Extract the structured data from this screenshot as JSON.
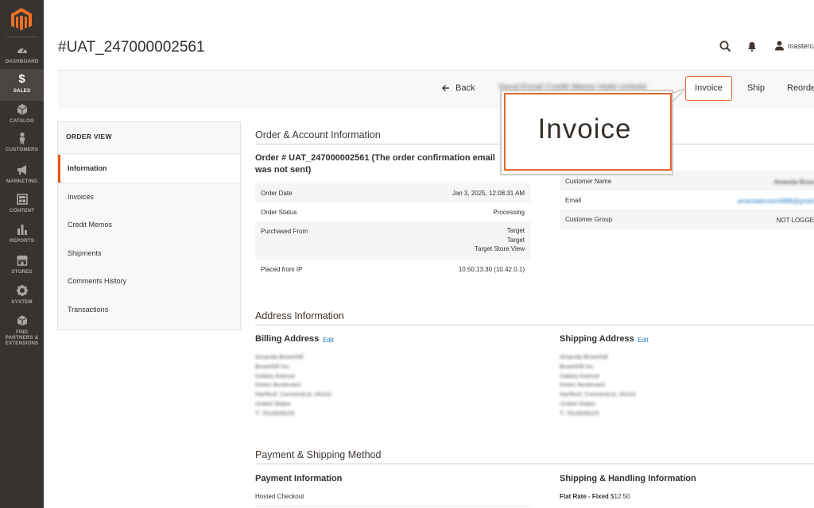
{
  "sidebar": {
    "items": [
      {
        "label": "DASHBOARD",
        "icon": "dashboard-icon"
      },
      {
        "label": "SALES",
        "icon": "dollar-icon"
      },
      {
        "label": "CATALOG",
        "icon": "cube-icon"
      },
      {
        "label": "CUSTOMERS",
        "icon": "person-icon"
      },
      {
        "label": "MARKETING",
        "icon": "megaphone-icon"
      },
      {
        "label": "CONTENT",
        "icon": "layout-icon"
      },
      {
        "label": "REPORTS",
        "icon": "bar-chart-icon"
      },
      {
        "label": "STORES",
        "icon": "store-icon"
      },
      {
        "label": "SYSTEM",
        "icon": "gear-icon"
      },
      {
        "label": "FIND PARTNERS & EXTENSIONS",
        "icon": "box-icon"
      }
    ],
    "active_index": 1
  },
  "header": {
    "title": "#UAT_247000002561",
    "username": "masterca"
  },
  "actions": {
    "back": "Back",
    "blurred": "Send Email  Credit Memo  Hold  Unhold",
    "invoice": "Invoice",
    "ship": "Ship",
    "reorder": "Reorde"
  },
  "callout": {
    "text": "Invoice"
  },
  "order_view": {
    "title": "ORDER VIEW",
    "tabs": [
      "Information",
      "Invoices",
      "Credit Memos",
      "Shipments",
      "Comments History",
      "Transactions"
    ],
    "active_tab": 0
  },
  "order_account": {
    "section_title": "Order & Account Information",
    "order_heading": "Order # UAT_247000002561 (The order confirmation email was not sent)",
    "rows": [
      {
        "key": "Order Date",
        "value": "Jan 3, 2025, 12:08:31 AM"
      },
      {
        "key": "Order Status",
        "value": "Processing"
      },
      {
        "key": "Purchased From",
        "value_lines": [
          "Target",
          "Target",
          "Target Store View"
        ]
      },
      {
        "key": "Placed from IP",
        "value": "10.50.13.30 (10.42.0.1)"
      }
    ],
    "account_rows": [
      {
        "key": "Customer Name",
        "value": "Amanda Brow"
      },
      {
        "key": "Email",
        "value": "amandabrownhill88@gmail"
      },
      {
        "key": "Customer Group",
        "value": "NOT LOGGE"
      }
    ]
  },
  "address": {
    "section_title": "Address Information",
    "billing_title": "Billing Address",
    "shipping_title": "Shipping Address",
    "edit_label": "Edit",
    "billing_lines": [
      "Amanda Brownhill",
      "Brownhill Inc.",
      "Galaxy Avenue",
      "Green Boulevard",
      "Hartford, Connecticut, 06102",
      "United States",
      "T: 7614639225"
    ],
    "shipping_lines": [
      "Amanda Brownhill",
      "Brownhill Inc.",
      "Galaxy Avenue",
      "Green Boulevard",
      "Hartford, Connecticut, 06102",
      "United States",
      "T: 7614639225"
    ]
  },
  "payment_shipping": {
    "section_title": "Payment & Shipping Method",
    "payment_title": "Payment Information",
    "payment_value": "Hosted Checkout",
    "shipping_title": "Shipping & Handling Information",
    "shipping_method": "Flat Rate - Fixed",
    "shipping_price": "$12.50"
  },
  "colors": {
    "accent": "#eb5202",
    "sidebar": "#373330",
    "link": "#1979c3"
  }
}
